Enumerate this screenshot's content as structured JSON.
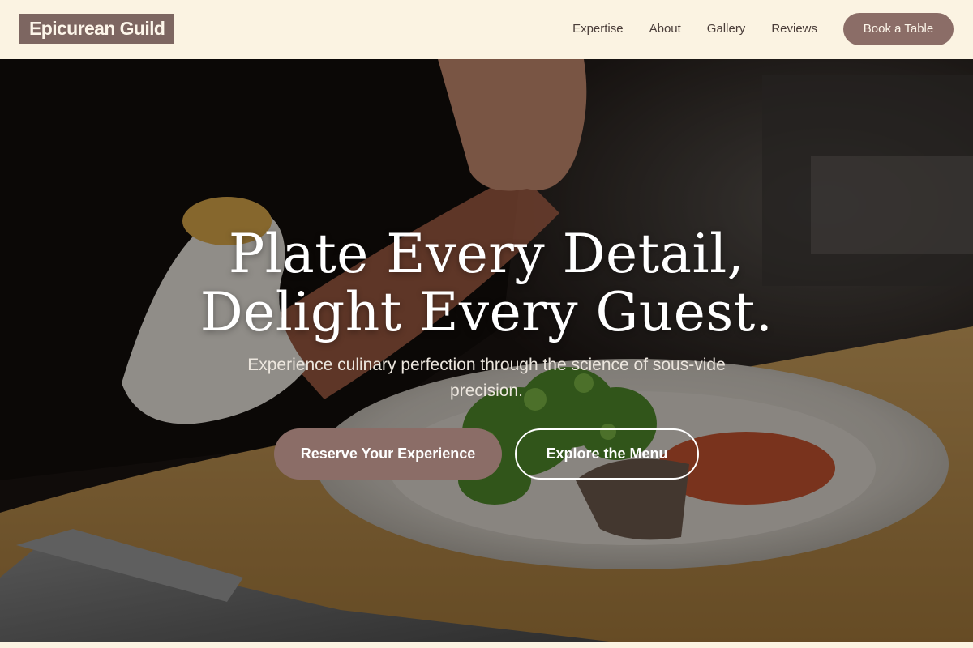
{
  "header": {
    "brand": "Epicurean Guild",
    "nav": [
      {
        "label": "Expertise"
      },
      {
        "label": "About"
      },
      {
        "label": "Gallery"
      },
      {
        "label": "Reviews"
      }
    ],
    "cta_label": "Book a Table"
  },
  "hero": {
    "title_line1": "Plate Every Detail,",
    "title_line2": "Delight Every Guest.",
    "subtitle": "Experience culinary perfection through the science of sous-vide precision.",
    "primary_button": "Reserve Your Experience",
    "secondary_button": "Explore the Menu"
  },
  "colors": {
    "background": "#fbf3e2",
    "accent": "#8b6d67",
    "brand_bg": "#7d6661"
  }
}
